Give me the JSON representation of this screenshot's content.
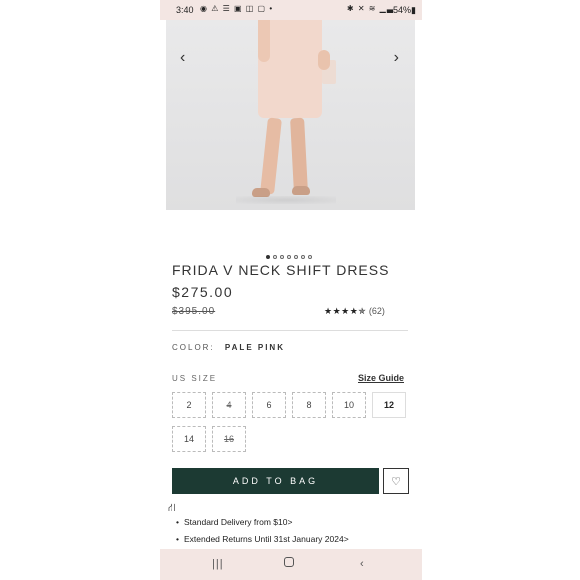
{
  "status_bar": {
    "time": "3:40",
    "left_icons": "◉ ⚠ ☰ ▣ ◫ ▢ •",
    "right_icons": "✱ ✕ ≋ ▁▃",
    "battery": "54%▮"
  },
  "gallery": {
    "prev_arrow": "‹",
    "next_arrow": "›",
    "dot_count": 7,
    "active_dot": 0
  },
  "product": {
    "title": "FRIDA V NECK SHIFT DRESS",
    "price": "$275.00",
    "original_price": "$395.00",
    "rating": {
      "stars": "★★★★✯",
      "value": 4.5,
      "count": "(62)"
    }
  },
  "color": {
    "label": "COLOR:",
    "value": "PALE PINK"
  },
  "sizes": {
    "label": "US SIZE",
    "guide": "Size Guide",
    "options": [
      {
        "label": "2",
        "available": true,
        "selected": false
      },
      {
        "label": "4",
        "available": false,
        "selected": false
      },
      {
        "label": "6",
        "available": true,
        "selected": false
      },
      {
        "label": "8",
        "available": true,
        "selected": false
      },
      {
        "label": "10",
        "available": true,
        "selected": false
      },
      {
        "label": "12",
        "available": true,
        "selected": true
      },
      {
        "label": "14",
        "available": true,
        "selected": false
      },
      {
        "label": "16",
        "available": false,
        "selected": false
      }
    ]
  },
  "actions": {
    "add_to_bag": "ADD TO BAG",
    "wishlist_icon": "♡"
  },
  "delivery": {
    "icon": "⛙",
    "items": [
      "Standard Delivery from $10>",
      "Extended Returns Until 31st January 2024>"
    ]
  },
  "nav_bar": {
    "recent": "|||",
    "back": "‹"
  },
  "colors": {
    "button_bg": "#1c3a33",
    "system_bar_bg": "#f3e6e3"
  }
}
